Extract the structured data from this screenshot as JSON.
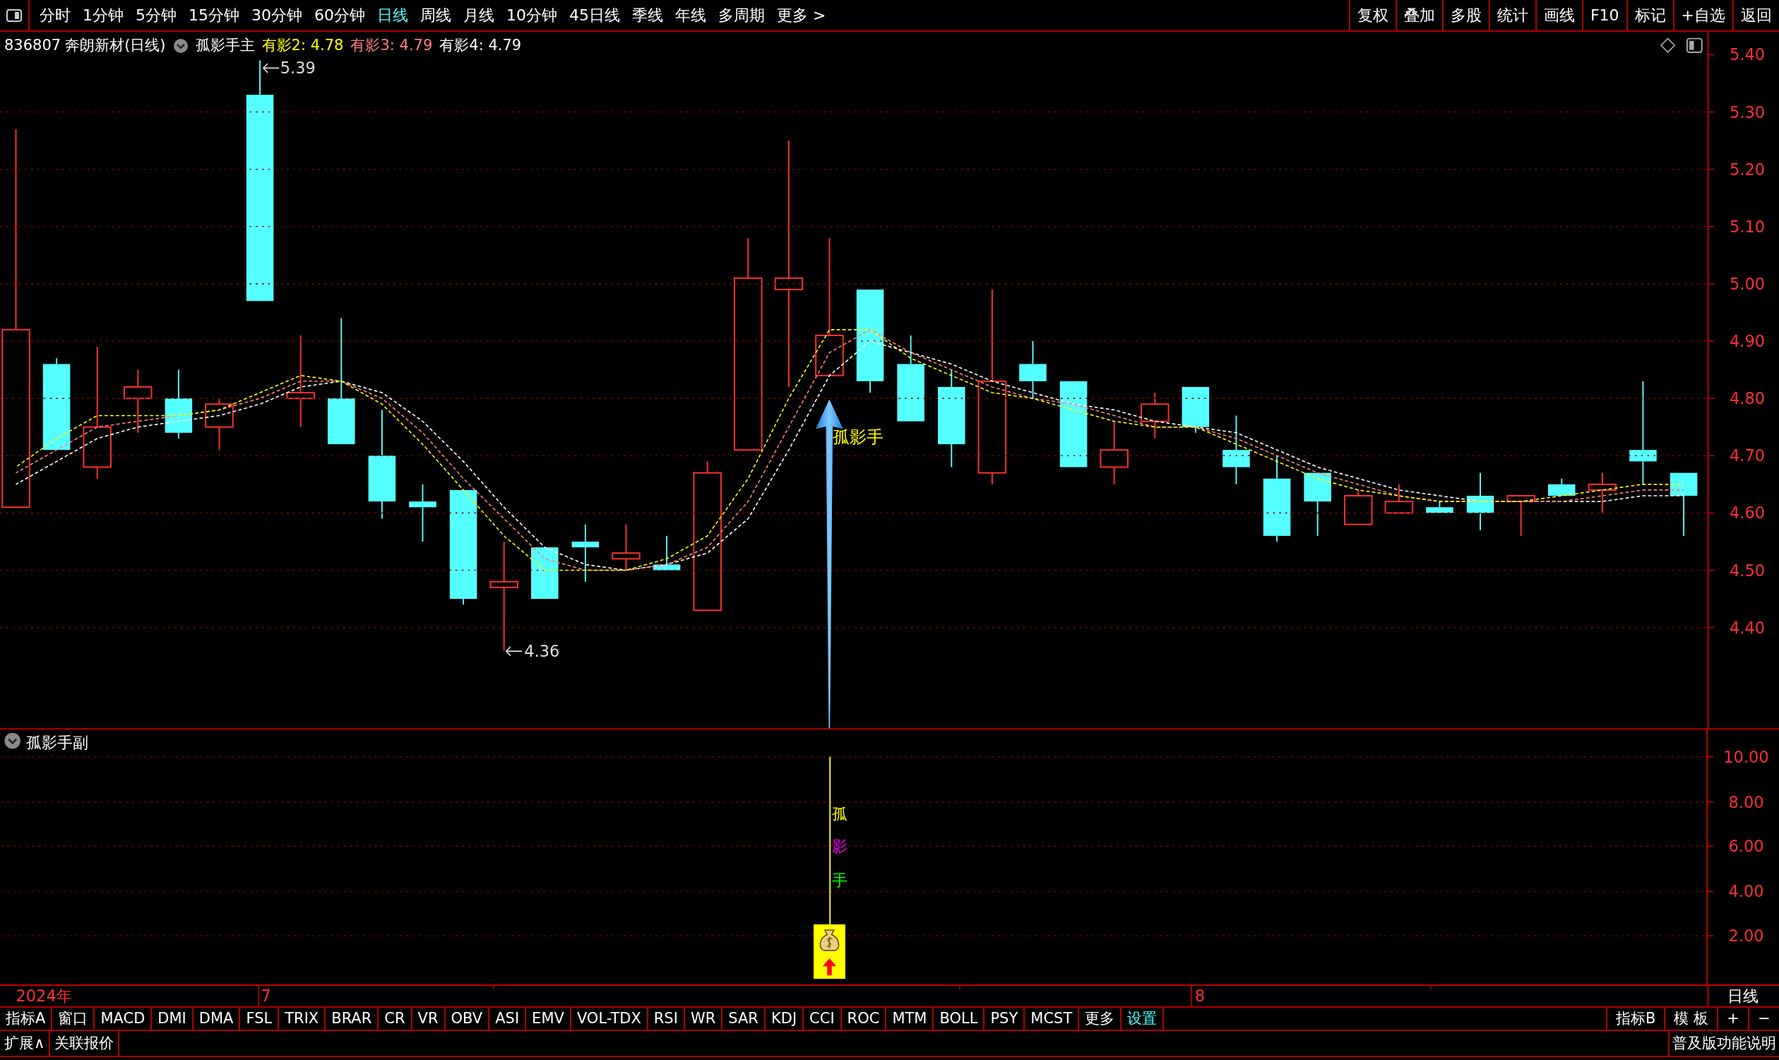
{
  "toolbar": {
    "periods": [
      {
        "label": "分时",
        "selected": false
      },
      {
        "label": "1分钟",
        "selected": false
      },
      {
        "label": "5分钟",
        "selected": false
      },
      {
        "label": "15分钟",
        "selected": false
      },
      {
        "label": "30分钟",
        "selected": false
      },
      {
        "label": "60分钟",
        "selected": false
      },
      {
        "label": "日线",
        "selected": true
      },
      {
        "label": "周线",
        "selected": false
      },
      {
        "label": "月线",
        "selected": false
      },
      {
        "label": "10分钟",
        "selected": false
      },
      {
        "label": "45日线",
        "selected": false
      },
      {
        "label": "季线",
        "selected": false
      },
      {
        "label": "年线",
        "selected": false
      },
      {
        "label": "多周期",
        "selected": false
      },
      {
        "label": "更多 >",
        "selected": false
      }
    ],
    "tools": [
      "复权",
      "叠加",
      "多股",
      "统计",
      "画线",
      "F10",
      "标记",
      "+自选",
      "返回"
    ]
  },
  "chart_header": {
    "code": "836807",
    "name": "奔朗新材(日线)",
    "indicator": "孤影手主",
    "values": [
      ": 4.78",
      ": 4.79",
      ": 4.79"
    ]
  },
  "chart_data": {
    "type": "line",
    "grid": true,
    "ylim": [
      4.222,
      5.44
    ],
    "yticks": [
      {
        "value": 5.4,
        "label": "5.40"
      },
      {
        "value": 5.3,
        "label": "5.30"
      },
      {
        "value": 5.2,
        "label": "5.20"
      },
      {
        "value": 5.1,
        "label": "5.10"
      },
      {
        "value": 5.0,
        "label": "5.00"
      },
      {
        "value": 4.9,
        "label": "4.90"
      },
      {
        "value": 4.8,
        "label": "4.80"
      },
      {
        "value": 4.7,
        "label": "4.70"
      },
      {
        "value": 4.6,
        "label": "4.60"
      },
      {
        "value": 4.5,
        "label": "4.50"
      },
      {
        "value": 4.4,
        "label": "4.40"
      }
    ],
    "series": [
      {
        "name": "有影2",
        "color": "#ffff00",
        "line_style": "dashed",
        "values": [
          4.68,
          4.73,
          4.77,
          4.77,
          4.77,
          4.78,
          4.81,
          4.84,
          4.83,
          4.79,
          4.72,
          4.64,
          4.56,
          4.5,
          4.5,
          4.5,
          4.52,
          4.56,
          4.66,
          4.8,
          4.92,
          4.92,
          4.87,
          4.84,
          4.81,
          4.8,
          4.78,
          4.76,
          4.75,
          4.75,
          4.72,
          4.69,
          4.66,
          4.64,
          4.63,
          4.62,
          4.62,
          4.62,
          4.63,
          4.64,
          4.65,
          4.65
        ]
      },
      {
        "name": "有影3",
        "color": "#ff7f7f",
        "line_style": "dashed",
        "values": [
          4.67,
          4.71,
          4.75,
          4.76,
          4.77,
          4.78,
          4.8,
          4.83,
          4.83,
          4.8,
          4.74,
          4.66,
          4.59,
          4.52,
          4.5,
          4.5,
          4.51,
          4.54,
          4.62,
          4.75,
          4.88,
          4.92,
          4.88,
          4.85,
          4.82,
          4.8,
          4.79,
          4.77,
          4.75,
          4.75,
          4.73,
          4.7,
          4.67,
          4.65,
          4.63,
          4.62,
          4.62,
          4.62,
          4.62,
          4.63,
          4.64,
          4.64
        ]
      },
      {
        "name": "有影4",
        "color": "#ffffff",
        "line_style": "dashed",
        "values": [
          4.65,
          4.69,
          4.73,
          4.75,
          4.76,
          4.77,
          4.79,
          4.82,
          4.83,
          4.81,
          4.76,
          4.69,
          4.61,
          4.54,
          4.51,
          4.5,
          4.51,
          4.53,
          4.59,
          4.71,
          4.84,
          4.9,
          4.88,
          4.86,
          4.83,
          4.81,
          4.79,
          4.78,
          4.76,
          4.75,
          4.74,
          4.71,
          4.68,
          4.66,
          4.64,
          4.63,
          4.62,
          4.62,
          4.62,
          4.62,
          4.63,
          4.63
        ]
      }
    ]
  },
  "annotations": {
    "high": "5.39",
    "low": "4.36",
    "signal": "孤影手"
  },
  "sub_chart": {
    "title": "孤影手副",
    "axis": [
      "10.00",
      "8.00",
      "6.00",
      "4.00",
      "2.00"
    ],
    "signal_chars": [
      {
        "text": "孤",
        "color": "#ffff00"
      },
      {
        "text": "影",
        "color": "#ff00ff"
      },
      {
        "text": "手",
        "color": "#00ff00"
      }
    ]
  },
  "time_axis": {
    "labels": [
      "2024年",
      "7",
      "8"
    ],
    "period": "日线"
  },
  "indicator_tabs": [
    {
      "label": "指标A",
      "highlighted": false
    },
    {
      "label": "窗口",
      "highlighted": false
    },
    {
      "label": "MACD",
      "highlighted": false
    },
    {
      "label": "DMI",
      "highlighted": false
    },
    {
      "label": "DMA",
      "highlighted": false
    },
    {
      "label": "FSL",
      "highlighted": false
    },
    {
      "label": "TRIX",
      "highlighted": false
    },
    {
      "label": "BRAR",
      "highlighted": false
    },
    {
      "label": "CR",
      "highlighted": false
    },
    {
      "label": "VR",
      "highlighted": false
    },
    {
      "label": "OBV",
      "highlighted": false
    },
    {
      "label": "ASI",
      "highlighted": false
    },
    {
      "label": "EMV",
      "highlighted": false
    },
    {
      "label": "VOL-TDX",
      "highlighted": false
    },
    {
      "label": "RSI",
      "highlighted": false
    },
    {
      "label": "WR",
      "highlighted": false
    },
    {
      "label": "SAR",
      "highlighted": false
    },
    {
      "label": "KDJ",
      "highlighted": false
    },
    {
      "label": "CCI",
      "highlighted": false
    },
    {
      "label": "ROC",
      "highlighted": false
    },
    {
      "label": "MTM",
      "highlighted": false
    },
    {
      "label": "BOLL",
      "highlighted": false
    },
    {
      "label": "PSY",
      "highlighted": false
    },
    {
      "label": "MCST",
      "highlighted": false
    },
    {
      "label": "更多",
      "highlighted": false
    },
    {
      "label": "设置",
      "highlighted": true
    }
  ],
  "right_tabs": [
    "指标B",
    "模 板",
    "+",
    "−"
  ],
  "bottom_bar": {
    "left": [
      "扩展∧",
      "关联报价"
    ],
    "right": "普及版功能说明"
  }
}
